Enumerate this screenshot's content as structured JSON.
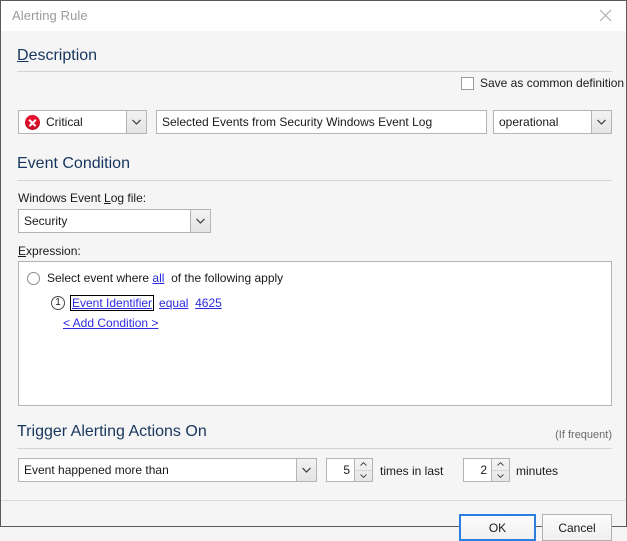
{
  "window": {
    "title": "Alerting Rule",
    "close_icon": "close-icon"
  },
  "description_section": {
    "title": "Description",
    "title_accel": "D",
    "title_rest": "escription",
    "save_common_label": "Save as common definition",
    "severity": {
      "value": "Critical",
      "icon": "critical-error-icon",
      "icon_color": "#e8112d"
    },
    "name_field": {
      "value": "Selected Events from Security Windows Event Log",
      "placeholder": ""
    },
    "category": {
      "value": "operational"
    }
  },
  "event_condition_section": {
    "title": "Event Condition",
    "log_file_label_accel_before": "Windows Event ",
    "log_file_label_accel": "L",
    "log_file_label_after": "og file:",
    "log_file_label_full": "Windows Event Log file:",
    "log_file": {
      "value": "Security"
    },
    "expression_label_accel": "E",
    "expression_label_after": "xpression:",
    "expression_label_full": "Expression:",
    "expression": {
      "select_prefix": "Select event where",
      "quantifier": "all",
      "select_suffix": "of the following apply",
      "conditions": [
        {
          "number": "1",
          "field": "Event Identifier",
          "operator": "equal",
          "value": "4625"
        }
      ],
      "add_condition": "< Add Condition >"
    }
  },
  "trigger_section": {
    "title": "Trigger Alerting Actions On",
    "note": "(If frequent)",
    "condition": {
      "value": "Event happened more than"
    },
    "count": {
      "value": "5"
    },
    "middle_label": "times in last",
    "minutes": {
      "value": "2"
    },
    "unit_label": "minutes"
  },
  "footer": {
    "ok_label": "OK",
    "cancel_label": "Cancel"
  }
}
